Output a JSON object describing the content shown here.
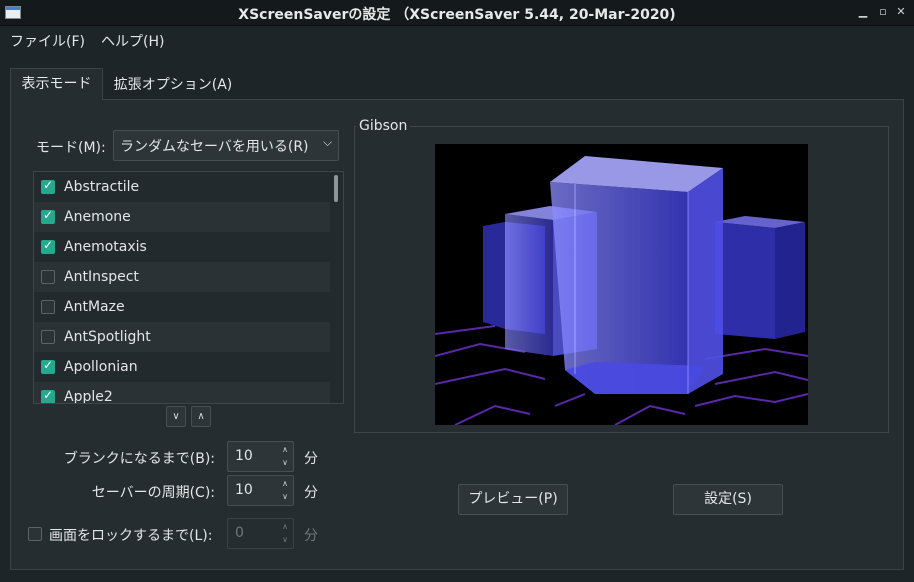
{
  "window": {
    "title": "XScreenSaverの設定 （XScreenSaver 5.44, 20-Mar-2020)",
    "controls": [
      "minimize-icon",
      "maximize-icon",
      "close-icon"
    ]
  },
  "menubar": {
    "items": [
      "ファイル(F)",
      "ヘルプ(H)"
    ]
  },
  "tabs": [
    {
      "label": "表示モード",
      "selected": true
    },
    {
      "label": "拡張オプション(A)",
      "selected": false
    }
  ],
  "mode": {
    "label": "モード(M):",
    "value": "ランダムなセーバを用いる(R)"
  },
  "savers": [
    {
      "name": "Abstractile",
      "checked": true
    },
    {
      "name": "Anemone",
      "checked": true
    },
    {
      "name": "Anemotaxis",
      "checked": true
    },
    {
      "name": "AntInspect",
      "checked": false
    },
    {
      "name": "AntMaze",
      "checked": false
    },
    {
      "name": "AntSpotlight",
      "checked": false
    },
    {
      "name": "Apollonian",
      "checked": true
    },
    {
      "name": "Apple2",
      "checked": true
    }
  ],
  "blank_after": {
    "label": "ブランクになるまで(B):",
    "value": "10",
    "unit": "分"
  },
  "cycle_after": {
    "label": "セーバーの周期(C):",
    "value": "10",
    "unit": "分"
  },
  "lock_after": {
    "label": "画面をロックするまで(L):",
    "value": "0",
    "unit": "分",
    "checked": false,
    "enabled": false
  },
  "preview": {
    "title": "Gibson"
  },
  "buttons": {
    "preview": "プレビュー(P)",
    "settings": "設定(S)"
  },
  "colors": {
    "accent": "#26a88e",
    "background": "#262d30"
  }
}
